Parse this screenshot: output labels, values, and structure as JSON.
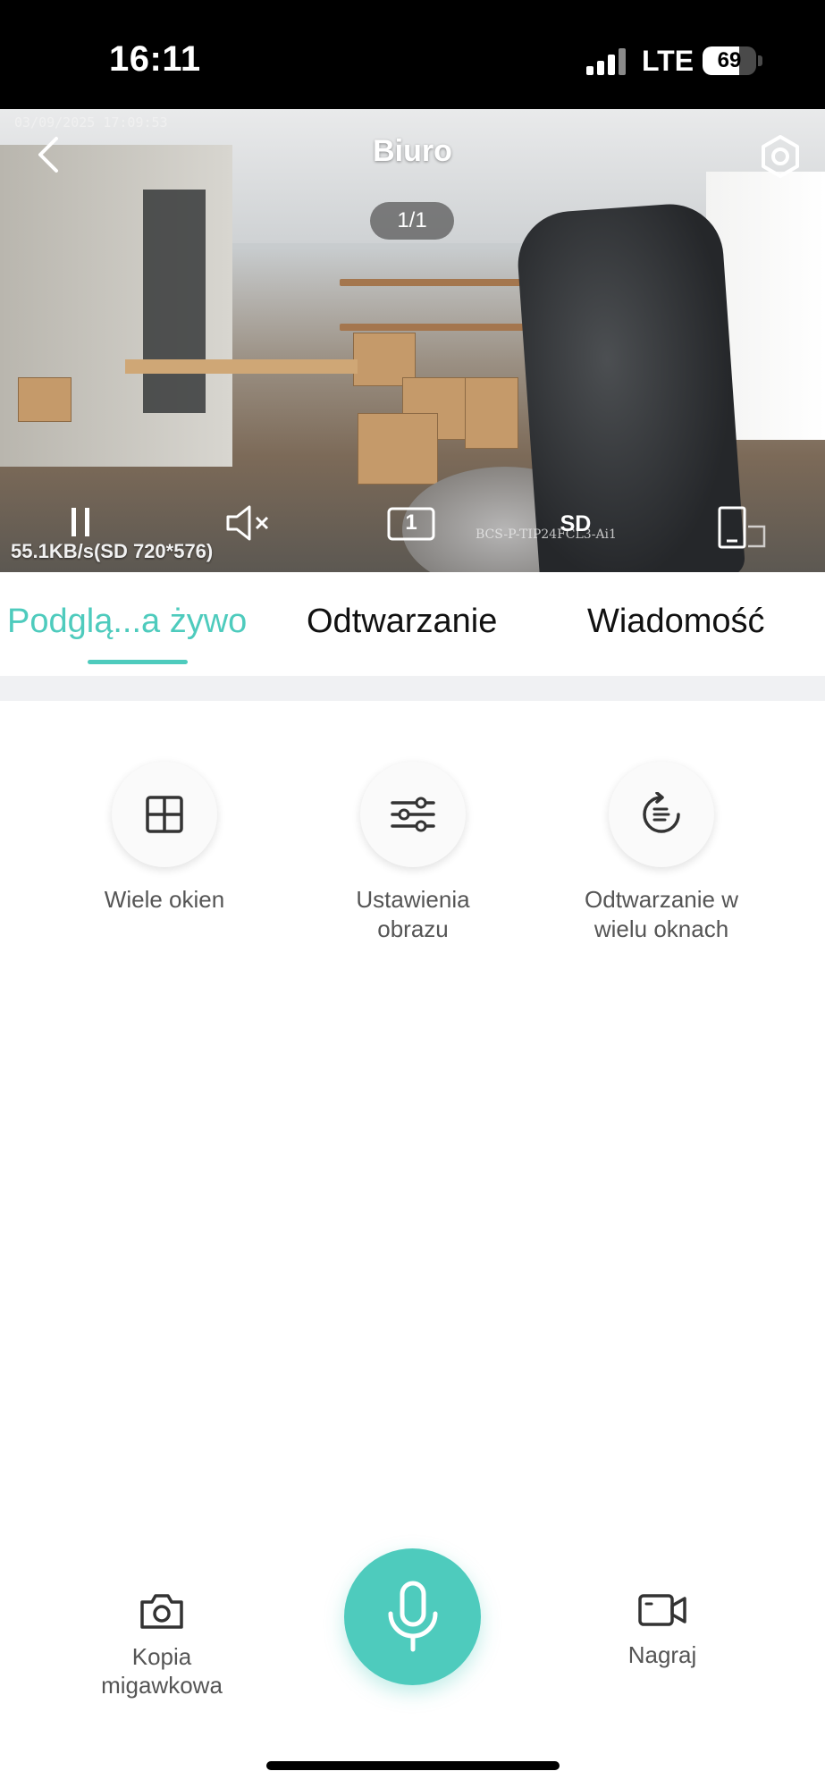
{
  "status_bar": {
    "time": "16:11",
    "network": "LTE",
    "battery_percent": "69",
    "battery_level": 0.69,
    "icons": [
      "signal-icon",
      "battery-icon"
    ]
  },
  "video": {
    "title": "Biuro",
    "page_indicator": "1/1",
    "timestamp": "03/09/2025 17:09:53",
    "watermark": "BCS-P-TIP24FCL3-Ai1",
    "bitrate": "55.1KB/s(SD 720*576)",
    "quality": "SD",
    "channel": "1",
    "icons": [
      "back-icon",
      "settings-icon",
      "pause-icon",
      "mute-icon",
      "channel-icon",
      "fullscreen-icon"
    ]
  },
  "tabs": [
    {
      "label": "Podglą...a żywo",
      "active": true
    },
    {
      "label": "Odtwarzanie",
      "active": false
    },
    {
      "label": "Wiadomość",
      "active": false
    }
  ],
  "functions": [
    {
      "label": "Wiele okien",
      "icon": "grid-icon"
    },
    {
      "label_line1": "Ustawienia",
      "label_line2": "obrazu",
      "icon": "sliders-icon"
    },
    {
      "label_line1": "Odtwarzanie w",
      "label_line2": "wielu oknach",
      "icon": "replay-icon"
    }
  ],
  "bottom": {
    "snapshot_line1": "Kopia",
    "snapshot_line2": "migawkowa",
    "record_label": "Nagraj",
    "icons": [
      "camera-icon",
      "microphone-icon",
      "video-camera-icon"
    ]
  },
  "colors": {
    "accent": "#4ecbbd",
    "status_bar_bg": "#000000",
    "separator": "#f0f1f3"
  }
}
